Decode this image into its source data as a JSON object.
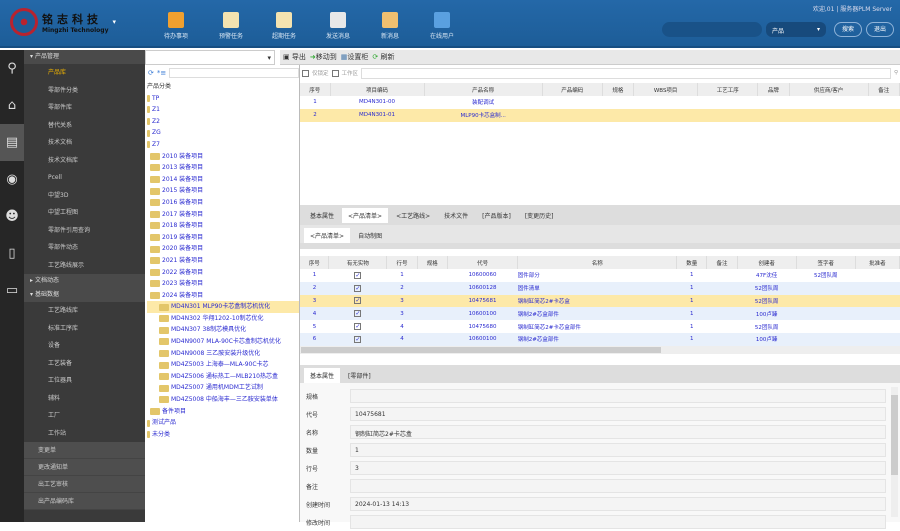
{
  "header": {
    "brand_cn": "铭志科技",
    "brand_en": "Mingzhi Technology",
    "welcome": "欢迎,01 | 服务器PLM Server",
    "nav": [
      {
        "label": "待办事项",
        "color": "#f0a030"
      },
      {
        "label": "预警任务",
        "color": "#f4e3b0"
      },
      {
        "label": "超期任务",
        "color": "#f4e3b0"
      },
      {
        "label": "发送消息",
        "color": "#e8e8e8"
      },
      {
        "label": "新消息",
        "color": "#f0c070"
      },
      {
        "label": "在线用户",
        "color": "#5aa0e0"
      }
    ],
    "search_scope": "产品",
    "search_btn": "搜索",
    "logout_btn": "退出"
  },
  "sidebar": {
    "groups": [
      {
        "label": "产品管理",
        "items": [
          "产品库",
          "零部件分类",
          "零部件库",
          "替代关系",
          "技术文档",
          "技术文档库",
          "Pcell",
          "中望3D",
          "中望工程图",
          "零部件引用查询",
          "零部件动态",
          "工艺路线展示"
        ]
      },
      {
        "label": "文档动态"
      },
      {
        "label": "基础数据",
        "items": [
          "工艺路线库",
          "标准工序库",
          "设备",
          "工艺装备",
          "工位器具",
          "辅料",
          "工厂",
          "工作站"
        ]
      }
    ],
    "tail": [
      "变更单",
      "更改通知单",
      "出工艺审核",
      "出产品编码库"
    ]
  },
  "toolbar": {
    "import": "导出",
    "move": "移动到",
    "set": "设置柜",
    "refresh": "刷新"
  },
  "tree": {
    "root": "产品分类",
    "nodes": [
      "TP",
      "Z1",
      "Z2",
      "ZG",
      "Z7",
      "2010 装备项目",
      "2013 装备项目",
      "2014 装备项目",
      "2015 装备项目",
      "2016 装备项目",
      "2017 装备项目",
      "2018 装备项目",
      "2019 装备项目",
      "2020 装备项目",
      "2021 装备项目",
      "2022 装备项目",
      "2023 装备项目",
      "2024 装备项目"
    ],
    "children": [
      "MD4N301 MLP90卡芯盒制芯机优化",
      "MD4N302 华翔1202-10制芯优化",
      "MD4N307 38制芯模具优化",
      "MD4N9007 MLA-90C卡芯盒制芯机优化",
      "MD4N9008 三乙胺安装升级优化",
      "MD4Z5003 上海泰—MLA-90C卡芯",
      "MD4Z5006 通标热工—MLB210热芯盒",
      "MD4Z5007 通用机MDM工艺试制",
      "MD4Z5008 中船海丰—三乙胺安装单体"
    ],
    "tail": [
      "备件项目",
      "测试产品",
      "未分类"
    ]
  },
  "grid": {
    "filter1": "仅锁定",
    "filter2": "工作区",
    "headers": [
      "序号",
      "项目编码",
      "产品名称",
      "产品编码",
      "规格",
      "WBS项目",
      "工艺工序",
      "品牌",
      "供应商/客户",
      "备注"
    ],
    "rows": [
      [
        "1",
        "MD4N301-00",
        "装配调试"
      ],
      [
        "2",
        "MD4N301-01",
        "MLP90卡芯盒制..."
      ]
    ]
  },
  "tabs": [
    "基本属性",
    "<产品清单>",
    "<工艺路线>",
    "技术文件",
    "[产品版本]",
    "[变更历史]"
  ],
  "subtabs": [
    "<产品清单>",
    "自动制图"
  ],
  "bom": {
    "headers": [
      "序号",
      "有无实物",
      "行号",
      "规格",
      "代号",
      "名称",
      "数量",
      "备注",
      "创建者",
      "签字者",
      "批准者"
    ],
    "rows": [
      [
        "1",
        "1",
        "",
        "10600060",
        "固件部分",
        "1",
        "",
        "47F沈佳",
        "52团队周"
      ],
      [
        "2",
        "2",
        "",
        "10600128",
        "固件清单",
        "1",
        "",
        "52团队周",
        ""
      ],
      [
        "3",
        "3",
        "",
        "10475681",
        "钢制缸简芯2#卡芯盒",
        "1",
        "",
        "52团队周",
        ""
      ],
      [
        "4",
        "3",
        "",
        "10600100",
        "钢制2#芯盒部件",
        "1",
        "",
        "100卢臻",
        ""
      ],
      [
        "5",
        "4",
        "",
        "10475680",
        "钢制缸简芯2#卡芯盒部件",
        "1",
        "",
        "52团队周",
        ""
      ],
      [
        "6",
        "4",
        "",
        "10600100",
        "钢制2#芯盒部件",
        "1",
        "",
        "100卢臻",
        ""
      ]
    ]
  },
  "detail": {
    "tabs": [
      "基本属性",
      "[零部件]"
    ],
    "fields": [
      [
        "规格",
        ""
      ],
      [
        "代号",
        "10475681"
      ],
      [
        "名称",
        "钢制缸简芯2#卡芯盒"
      ],
      [
        "数量",
        "1"
      ],
      [
        "行号",
        "3"
      ],
      [
        "备注",
        ""
      ],
      [
        "创建时间",
        "2024-01-13 14:13"
      ],
      [
        "修改时间",
        ""
      ]
    ]
  }
}
